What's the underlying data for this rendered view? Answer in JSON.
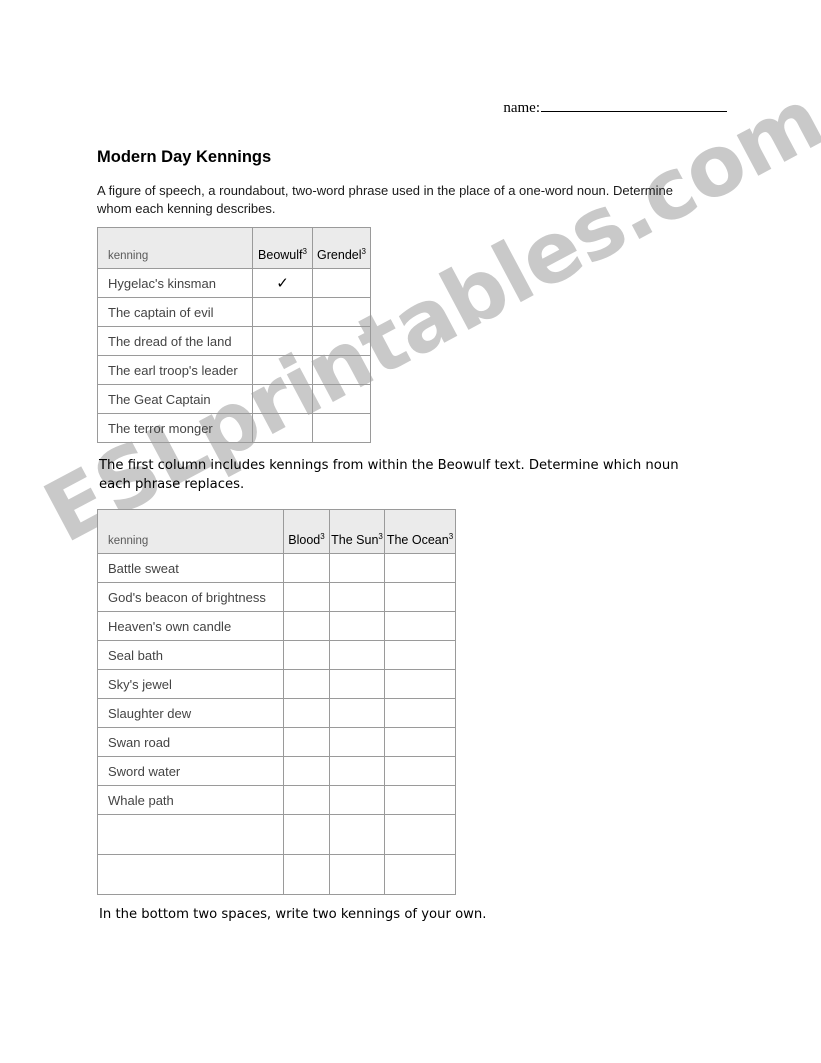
{
  "header": {
    "name_label": "name:",
    "name_value": ""
  },
  "title": "Modern Day Kennings",
  "intro": "A figure of speech, a roundabout, two-word phrase used in the place of a one-word noun.  Determine whom each kenning describes.",
  "note_1": "The first column includes kennings from within the Beowulf text.  Determine which noun each phrase replaces.",
  "note_2": "In the bottom two spaces, write two kennings of your own.",
  "watermark": "ESLprintables.com",
  "colors": {
    "header_fill": "#ebebeb",
    "border": "#9a9a9a",
    "body_text": "#444444",
    "watermark": "#c9c9c9"
  },
  "table_people": {
    "headers": {
      "kenning": "kenning",
      "option_1": "Beowulf",
      "option_1_sup": "3",
      "option_2": "Grendel",
      "option_2_sup": "3"
    },
    "rows": [
      {
        "kenning": "Hygelac's kinsman",
        "option_1": "✓",
        "option_2": ""
      },
      {
        "kenning": "The captain of evil",
        "option_1": "",
        "option_2": ""
      },
      {
        "kenning": "The dread of the land",
        "option_1": "",
        "option_2": ""
      },
      {
        "kenning": "The earl troop's leader",
        "option_1": "",
        "option_2": ""
      },
      {
        "kenning": "The Geat Captain",
        "option_1": "",
        "option_2": ""
      },
      {
        "kenning": "The terror monger",
        "option_1": "",
        "option_2": ""
      }
    ]
  },
  "table_nouns": {
    "headers": {
      "kenning": "kenning",
      "option_1": "Blood",
      "option_1_sup": "3",
      "option_2": "The Sun",
      "option_2_sup": "3",
      "option_3": "The Ocean",
      "option_3_sup": "3"
    },
    "rows": [
      {
        "kenning": "Battle sweat",
        "option_1": "",
        "option_2": "",
        "option_3": ""
      },
      {
        "kenning": "God's beacon of brightness",
        "option_1": "",
        "option_2": "",
        "option_3": ""
      },
      {
        "kenning": "Heaven's own candle",
        "option_1": "",
        "option_2": "",
        "option_3": ""
      },
      {
        "kenning": "Seal bath",
        "option_1": "",
        "option_2": "",
        "option_3": ""
      },
      {
        "kenning": "Sky's jewel",
        "option_1": "",
        "option_2": "",
        "option_3": ""
      },
      {
        "kenning": "Slaughter dew",
        "option_1": "",
        "option_2": "",
        "option_3": ""
      },
      {
        "kenning": "Swan road",
        "option_1": "",
        "option_2": "",
        "option_3": ""
      },
      {
        "kenning": "Sword water",
        "option_1": "",
        "option_2": "",
        "option_3": ""
      },
      {
        "kenning": "Whale path",
        "option_1": "",
        "option_2": "",
        "option_3": ""
      },
      {
        "kenning": "",
        "option_1": "",
        "option_2": "",
        "option_3": ""
      },
      {
        "kenning": "",
        "option_1": "",
        "option_2": "",
        "option_3": ""
      }
    ]
  }
}
